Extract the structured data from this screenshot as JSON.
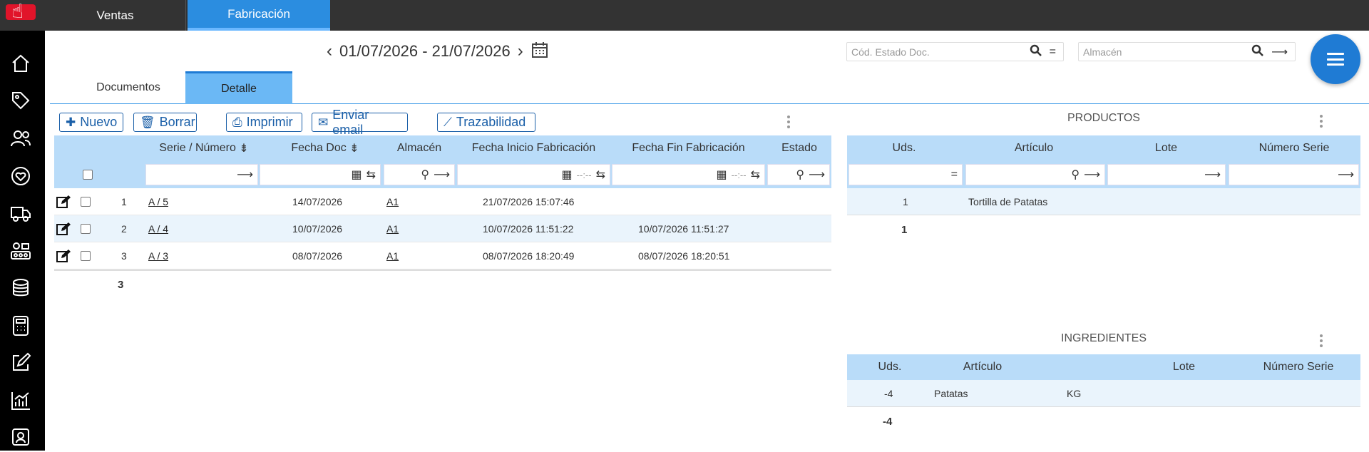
{
  "top_tabs": [
    {
      "label": "Ventas"
    },
    {
      "label": "Fabricación"
    }
  ],
  "date_range": "01/07/2026 - 21/07/2026",
  "filters": {
    "estado_placeholder": "Cód. Estado Doc.",
    "estado_op": "=",
    "almacen_placeholder": "Almacén",
    "almacen_op": "⟶"
  },
  "sub_tabs": [
    {
      "label": "Documentos"
    },
    {
      "label": "Detalle"
    }
  ],
  "toolbar": {
    "nuevo": "Nuevo",
    "borrar": "Borrar",
    "imprimir": "Imprimir",
    "enviar_email": "Enviar email",
    "trazabilidad": "Trazabilidad"
  },
  "main_table": {
    "headers": {
      "serie": "Serie / Número",
      "fecha_doc": "Fecha Doc",
      "almacen": "Almacén",
      "fecha_inicio": "Fecha Inicio Fabricación",
      "fecha_fin": "Fecha Fin Fabricación",
      "estado": "Estado"
    },
    "filter_time_placeholder": "--:--",
    "rows": [
      {
        "n": "1",
        "serie": "A / 5",
        "fecha_doc": "14/07/2026",
        "almacen": "A1",
        "inicio": "21/07/2026 15:07:46",
        "fin": ""
      },
      {
        "n": "2",
        "serie": "A / 4",
        "fecha_doc": "10/07/2026",
        "almacen": "A1",
        "inicio": "10/07/2026 11:51:22",
        "fin": "10/07/2026 11:51:27"
      },
      {
        "n": "3",
        "serie": "A / 3",
        "fecha_doc": "08/07/2026",
        "almacen": "A1",
        "inicio": "08/07/2026 18:20:49",
        "fin": "08/07/2026 18:20:51"
      }
    ],
    "total": "3"
  },
  "productos": {
    "title": "PRODUCTOS",
    "headers": {
      "uds": "Uds.",
      "articulo": "Artículo",
      "lote": "Lote",
      "serie": "Número Serie"
    },
    "filter_ops": {
      "uds": "=",
      "articulo": "⟶",
      "lote": "⟶",
      "serie": "⟶"
    },
    "rows": [
      {
        "uds": "1",
        "articulo": "Tortilla de Patatas"
      }
    ],
    "total": "1"
  },
  "ingredientes": {
    "title": "INGREDIENTES",
    "headers": {
      "uds": "Uds.",
      "articulo": "Artículo",
      "lote": "Lote",
      "serie": "Número Serie"
    },
    "rows": [
      {
        "uds": "-4",
        "articulo": "Patatas",
        "unidad": "KG"
      }
    ],
    "total": "-4"
  },
  "sidebar_icons": [
    "home-icon",
    "tag-icon",
    "users-icon",
    "heart-icon",
    "truck-icon",
    "factory-icon",
    "coins-icon",
    "calculator-icon",
    "edit-icon",
    "chart-icon",
    "contact-icon"
  ]
}
